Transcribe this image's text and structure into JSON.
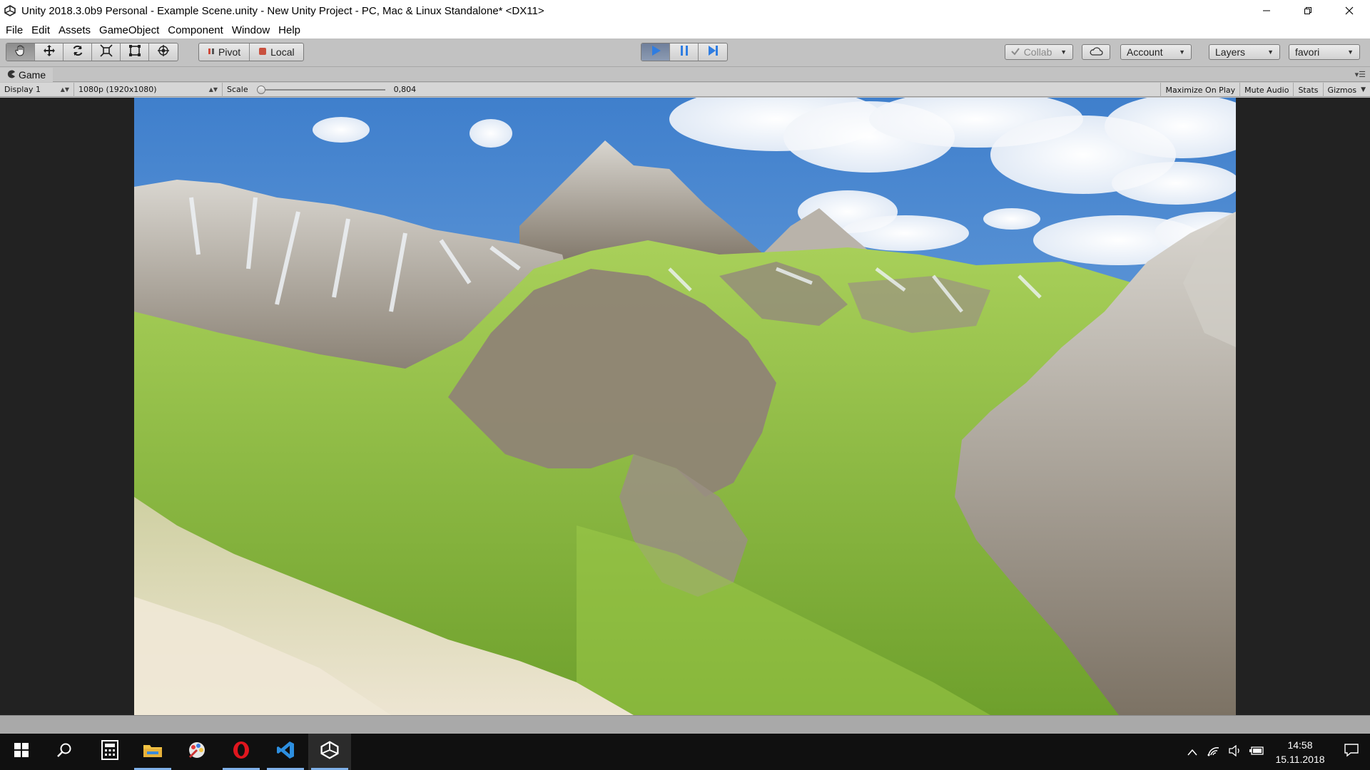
{
  "window": {
    "title": "Unity 2018.3.0b9 Personal - Example Scene.unity - New Unity Project - PC, Mac & Linux Standalone* <DX11>"
  },
  "menu": [
    "File",
    "Edit",
    "Assets",
    "GameObject",
    "Component",
    "Window",
    "Help"
  ],
  "toolbar": {
    "tools": [
      "hand-tool",
      "move-tool",
      "rotate-tool",
      "scale-tool",
      "rect-tool",
      "transform-tool"
    ],
    "pivot_label": "Pivot",
    "local_label": "Local",
    "collab_label": "Collab",
    "account_label": "Account",
    "layers_label": "Layers",
    "layout_label": "favori"
  },
  "game_tab": {
    "label": "Game"
  },
  "game_bar": {
    "display": "Display 1",
    "resolution": "1080p (1920x1080)",
    "scale_label": "Scale",
    "scale_value": "0,804",
    "maximize_on_play": "Maximize On Play",
    "mute_audio": "Mute Audio",
    "stats": "Stats",
    "gizmos": "Gizmos"
  },
  "taskbar": {
    "time": "14:58",
    "date": "15.11.2018"
  },
  "colors": {
    "play_active": "#2f7de1",
    "sky": "#4f8fd6",
    "grass": "#8bbf3a",
    "rock": "#8d8274",
    "sand": "#ddd4bf"
  }
}
